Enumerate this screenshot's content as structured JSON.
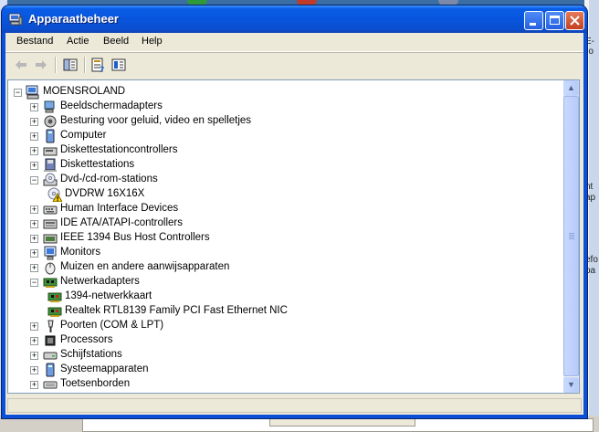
{
  "window": {
    "title": "Apparaatbeheer",
    "accent": "#0c50d8"
  },
  "menu": {
    "items": [
      {
        "label": "Bestand"
      },
      {
        "label": "Actie"
      },
      {
        "label": "Beeld"
      },
      {
        "label": "Help"
      }
    ]
  },
  "toolbar": {
    "buttons": [
      "back-arrow-icon",
      "forward-arrow-icon",
      "show-hide-console-tree-icon",
      "properties-icon",
      "help-icon"
    ]
  },
  "tree": {
    "root": "MOENSROLAND",
    "items": [
      {
        "label": "Beeldschermadapters",
        "icon": "display-adapter-icon",
        "expanded": false
      },
      {
        "label": "Besturing voor geluid, video en spelletjes",
        "icon": "sound-icon",
        "expanded": false
      },
      {
        "label": "Computer",
        "icon": "computer-icon",
        "expanded": false
      },
      {
        "label": "Diskettestationcontrollers",
        "icon": "floppy-controller-icon",
        "expanded": false
      },
      {
        "label": "Diskettestations",
        "icon": "floppy-drive-icon",
        "expanded": false
      },
      {
        "label": "Dvd-/cd-rom-stations",
        "icon": "cdrom-icon",
        "expanded": true
      },
      {
        "label": "DVDRW 16X16X",
        "icon": "cdrom-warning-icon",
        "child": true
      },
      {
        "label": "Human Interface Devices",
        "icon": "hid-icon",
        "expanded": false
      },
      {
        "label": "IDE ATA/ATAPI-controllers",
        "icon": "ide-controller-icon",
        "expanded": false
      },
      {
        "label": "IEEE 1394 Bus Host Controllers",
        "icon": "firewire-icon",
        "expanded": false
      },
      {
        "label": "Monitors",
        "icon": "monitor-icon",
        "expanded": false
      },
      {
        "label": "Muizen en andere aanwijsapparaten",
        "icon": "mouse-icon",
        "expanded": false
      },
      {
        "label": "Netwerkadapters",
        "icon": "network-adapter-icon",
        "expanded": true
      },
      {
        "label": "1394-netwerkkaart",
        "icon": "network-card-icon",
        "child": true
      },
      {
        "label": "Realtek RTL8139 Family PCI Fast Ethernet NIC",
        "icon": "network-card-icon",
        "child": true
      },
      {
        "label": "Poorten (COM & LPT)",
        "icon": "port-icon",
        "expanded": false
      },
      {
        "label": "Processors",
        "icon": "processor-icon",
        "expanded": false
      },
      {
        "label": "Schijfstations",
        "icon": "disk-drive-icon",
        "expanded": false
      },
      {
        "label": "Systeemapparaten",
        "icon": "system-device-icon",
        "expanded": false
      },
      {
        "label": "Toetsenborden",
        "icon": "keyboard-icon",
        "expanded": false
      }
    ]
  },
  "desktop": {
    "right_fragments": [
      "E-",
      "ro",
      "nt",
      "ap",
      "efo",
      "pa"
    ]
  }
}
